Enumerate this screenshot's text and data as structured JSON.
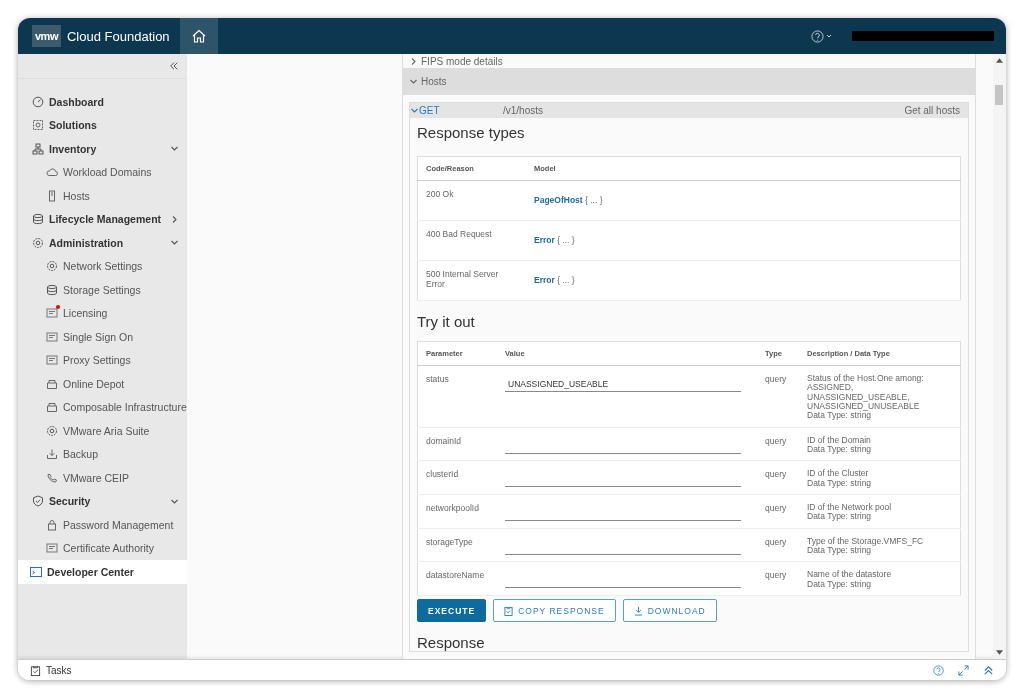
{
  "header": {
    "logo": "vmw",
    "product": "Cloud Foundation",
    "home_selected": true
  },
  "sidebar": {
    "items": [
      {
        "label": "Dashboard",
        "selected": false
      },
      {
        "label": "Solutions",
        "selected": false
      },
      {
        "label": "Inventory",
        "selected": false,
        "expanded": true,
        "children": [
          {
            "label": "Workload Domains",
            "selected": false
          },
          {
            "label": "Hosts",
            "selected": false
          }
        ]
      },
      {
        "label": "Lifecycle Management",
        "selected": false,
        "expanded": false
      },
      {
        "label": "Administration",
        "selected": false,
        "expanded": true,
        "children": [
          {
            "label": "Network Settings",
            "selected": false
          },
          {
            "label": "Storage Settings",
            "selected": false
          },
          {
            "label": "Licensing",
            "selected": false,
            "alert": true
          },
          {
            "label": "Single Sign On",
            "selected": false
          },
          {
            "label": "Proxy Settings",
            "selected": false
          },
          {
            "label": "Online Depot",
            "selected": false
          },
          {
            "label": "Composable Infrastructure",
            "selected": false
          },
          {
            "label": "VMware Aria Suite",
            "selected": false
          },
          {
            "label": "Backup",
            "selected": false
          },
          {
            "label": "VMware CEIP",
            "selected": false
          }
        ]
      },
      {
        "label": "Security",
        "selected": false,
        "expanded": true,
        "children": [
          {
            "label": "Password Management",
            "selected": false
          },
          {
            "label": "Certificate Authority",
            "selected": false
          }
        ]
      },
      {
        "label": "Developer Center",
        "selected": true
      }
    ]
  },
  "api": {
    "sections": [
      {
        "label": "FIPS mode details",
        "expanded": false
      },
      {
        "label": "Hosts",
        "expanded": true
      }
    ],
    "endpoint": {
      "method": "GET",
      "path": "/v1/hosts",
      "summary": "Get all hosts",
      "expanded": true
    },
    "response_types": {
      "title": "Response types",
      "columns": [
        "Code/Reason",
        "Model"
      ],
      "rows": [
        {
          "code": "200 Ok",
          "model": "PageOfHost",
          "suffix": "{ ... }"
        },
        {
          "code": "400 Bad Request",
          "model": "Error",
          "suffix": "{ ... }"
        },
        {
          "code": "500 Internal Server Error",
          "model": "Error",
          "suffix": "{ ... }"
        }
      ]
    },
    "try_it_out": {
      "title": "Try it out",
      "columns": [
        "Parameter",
        "Value",
        "Type",
        "Description / Data Type"
      ],
      "rows": [
        {
          "parameter": "status",
          "value": "UNASSIGNED_USEABLE",
          "type": "query",
          "description": [
            "Status of the Host.One among:",
            "ASSIGNED,",
            "UNASSIGNED_USEABLE,",
            "UNASSIGNED_UNUSEABLE",
            "Data Type: string"
          ]
        },
        {
          "parameter": "domainId",
          "type": "query",
          "description": [
            "ID of the Domain",
            "Data Type: string"
          ]
        },
        {
          "parameter": "clusterId",
          "type": "query",
          "description": [
            "ID of the Cluster",
            "Data Type: string"
          ]
        },
        {
          "parameter": "networkpoolId",
          "type": "query",
          "description": [
            "ID of the Network pool",
            "Data Type: string"
          ]
        },
        {
          "parameter": "storageType",
          "type": "query",
          "description": [
            "Type of the Storage.VMFS_FC",
            "Data Type: string"
          ]
        },
        {
          "parameter": "datastoreName",
          "type": "query",
          "description": [
            "Name of the datastore",
            "Data Type: string"
          ]
        }
      ]
    },
    "buttons": [
      {
        "label": "EXECUTE",
        "kind": "primary"
      },
      {
        "label": "COPY RESPONSE",
        "kind": "copy"
      },
      {
        "label": "DOWNLOAD",
        "kind": "download"
      }
    ],
    "response_title": "Response"
  },
  "footer": {
    "tasks": "Tasks"
  }
}
